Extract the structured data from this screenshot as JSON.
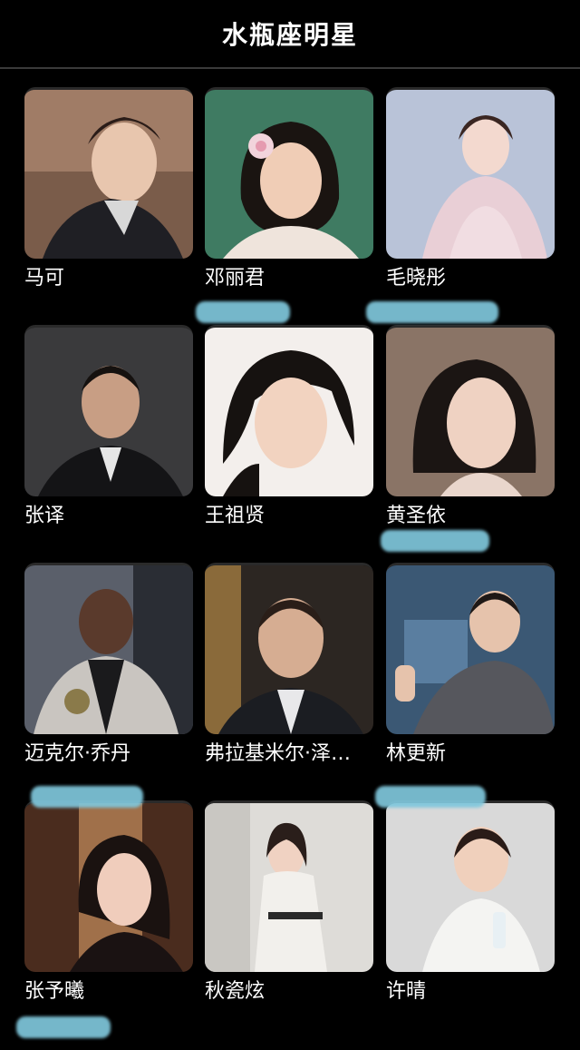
{
  "header": {
    "title": "水瓶座明星"
  },
  "celebrities": [
    {
      "name": "马可",
      "icon": "portrait-photo-icon"
    },
    {
      "name": "邓丽君",
      "icon": "portrait-photo-icon"
    },
    {
      "name": "毛晓彤",
      "icon": "portrait-photo-icon"
    },
    {
      "name": "张译",
      "icon": "portrait-photo-icon"
    },
    {
      "name": "王祖贤",
      "icon": "portrait-photo-icon"
    },
    {
      "name": "黄圣依",
      "icon": "portrait-photo-icon"
    },
    {
      "name": "迈克尔·乔丹",
      "icon": "portrait-photo-icon"
    },
    {
      "name": "弗拉基米尔·泽…",
      "icon": "portrait-photo-icon"
    },
    {
      "name": "林更新",
      "icon": "portrait-photo-icon"
    },
    {
      "name": "张予曦",
      "icon": "portrait-photo-icon"
    },
    {
      "name": "秋瓷炫",
      "icon": "portrait-photo-icon"
    },
    {
      "name": "许晴",
      "icon": "portrait-photo-icon"
    }
  ],
  "colors": {
    "background": "#000000",
    "text": "#ffffff",
    "divider": "#3a3a3a",
    "highlight_mark": "#7fc7dc"
  }
}
